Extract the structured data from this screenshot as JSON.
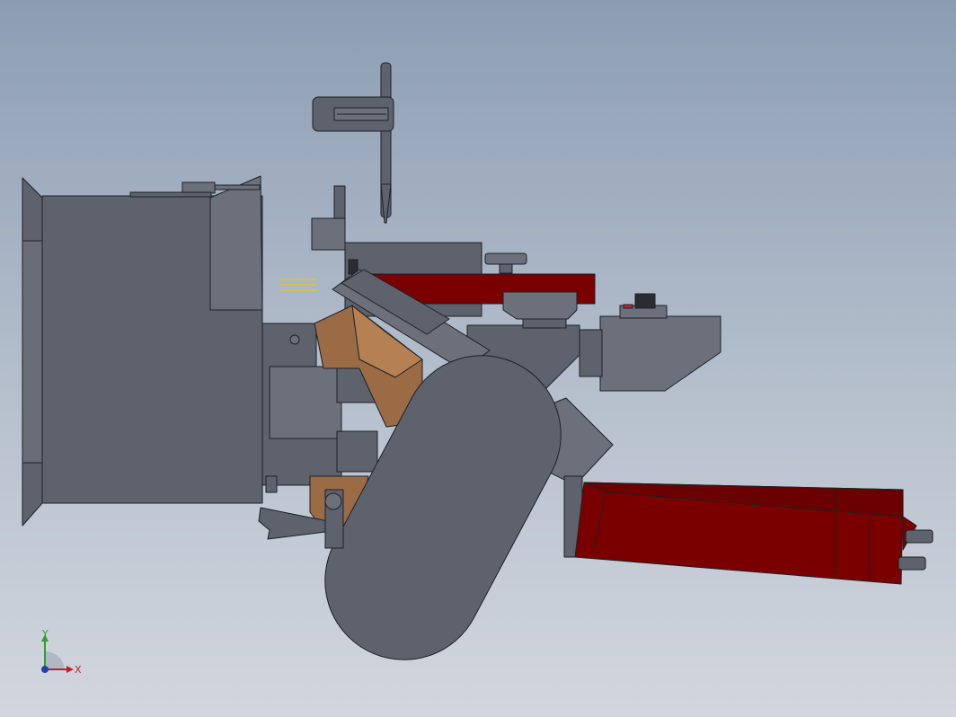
{
  "viewport": {
    "background_top": "#8c9db3",
    "background_bottom": "#d2d6de"
  },
  "colors": {
    "body_gray": "#5d626c",
    "body_gray_light": "#6b707a",
    "edge": "#1e2026",
    "accent_red": "#7a0000",
    "accent_red_dark": "#5c0000",
    "bronze": "#9b6b45",
    "bronze_light": "#b58052",
    "axis_x": "#c0202a",
    "axis_y": "#2fa02f",
    "axis_z": "#2040b0"
  },
  "triad": {
    "x_label": "X",
    "y_label": "Y"
  }
}
